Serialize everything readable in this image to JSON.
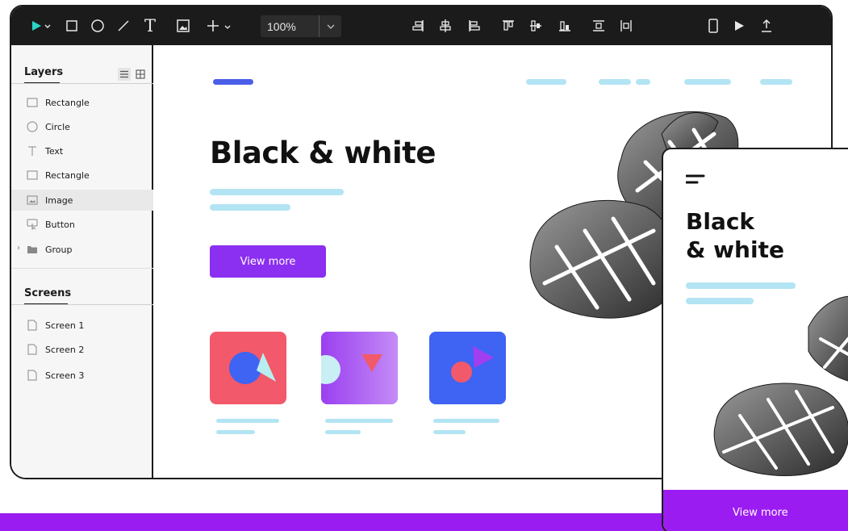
{
  "toolbar": {
    "tools": [
      {
        "name": "select-tool",
        "icon": "pointer-icon"
      },
      {
        "name": "rectangle-tool",
        "icon": "square-icon"
      },
      {
        "name": "ellipse-tool",
        "icon": "circle-icon"
      },
      {
        "name": "line-tool",
        "icon": "line-icon"
      },
      {
        "name": "text-tool",
        "icon": "text-icon"
      },
      {
        "name": "image-tool",
        "icon": "image-icon"
      },
      {
        "name": "add-tool",
        "icon": "plus-icon"
      }
    ],
    "text_tool_glyph": "T",
    "zoom": "100%",
    "align_tools": [
      "align-right-icon",
      "align-center-horizontal-icon",
      "align-left-icon",
      "align-top-icon",
      "align-middle-icon",
      "align-bottom-icon",
      "distribute-vertical-icon",
      "distribute-horizontal-icon"
    ],
    "right_tools": [
      "device-preview-icon",
      "play-icon",
      "export-icon"
    ],
    "accent_color": "#2bd4c8"
  },
  "sidebar": {
    "layers_title": "Layers",
    "layers": [
      {
        "label": "Rectangle",
        "icon": "square-icon",
        "selected": false
      },
      {
        "label": "Circle",
        "icon": "circle-icon",
        "selected": false
      },
      {
        "label": "Text",
        "icon": "text-icon",
        "selected": false
      },
      {
        "label": "Rectangle",
        "icon": "square-icon",
        "selected": false
      },
      {
        "label": "Image",
        "icon": "image-icon",
        "selected": true
      },
      {
        "label": "Button",
        "icon": "button-icon",
        "selected": false
      },
      {
        "label": "Group",
        "icon": "folder-icon",
        "selected": false
      }
    ],
    "screens_title": "Screens",
    "screens": [
      {
        "label": "Screen 1",
        "icon": "page-icon"
      },
      {
        "label": "Screen 2",
        "icon": "page-icon"
      },
      {
        "label": "Screen 3",
        "icon": "page-icon"
      }
    ]
  },
  "canvas": {
    "hero_title": "Black & white",
    "cta_label": "View more",
    "colors": {
      "nav_pill": "#4a5ee8",
      "light_pill": "#b3e4f3",
      "cta": "#8b2ff0",
      "card_red": "#f2596a",
      "card_purple": "#9b3ff0",
      "card_blue": "#3f63f2"
    }
  },
  "phone": {
    "title_line1": "Black",
    "title_line2": "& white",
    "cta_label": "View more",
    "cta_color": "#9b1cf0"
  }
}
